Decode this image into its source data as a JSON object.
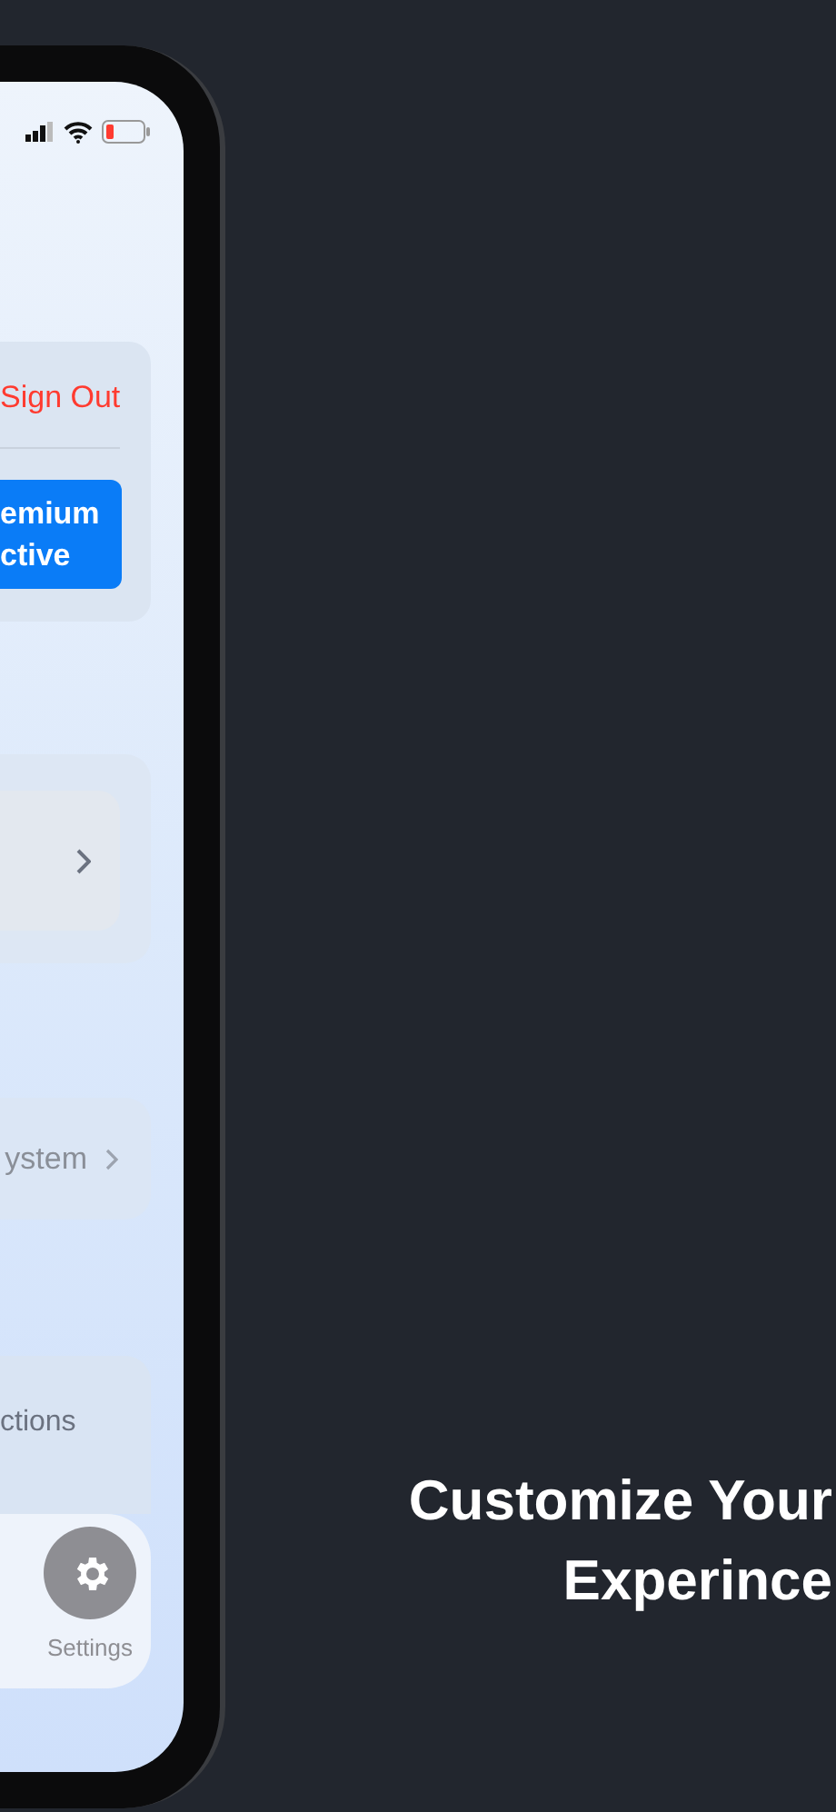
{
  "account_card": {
    "sign_out": "Sign Out",
    "premium_button": "emium ctive"
  },
  "system_row": {
    "label": "ystem"
  },
  "actions_card": {
    "label": "ctions"
  },
  "tab_bar": {
    "items": [
      {
        "label": "Settings",
        "selected": true
      }
    ]
  },
  "headline": {
    "lines": [
      "Customize Your",
      "Experince"
    ]
  }
}
